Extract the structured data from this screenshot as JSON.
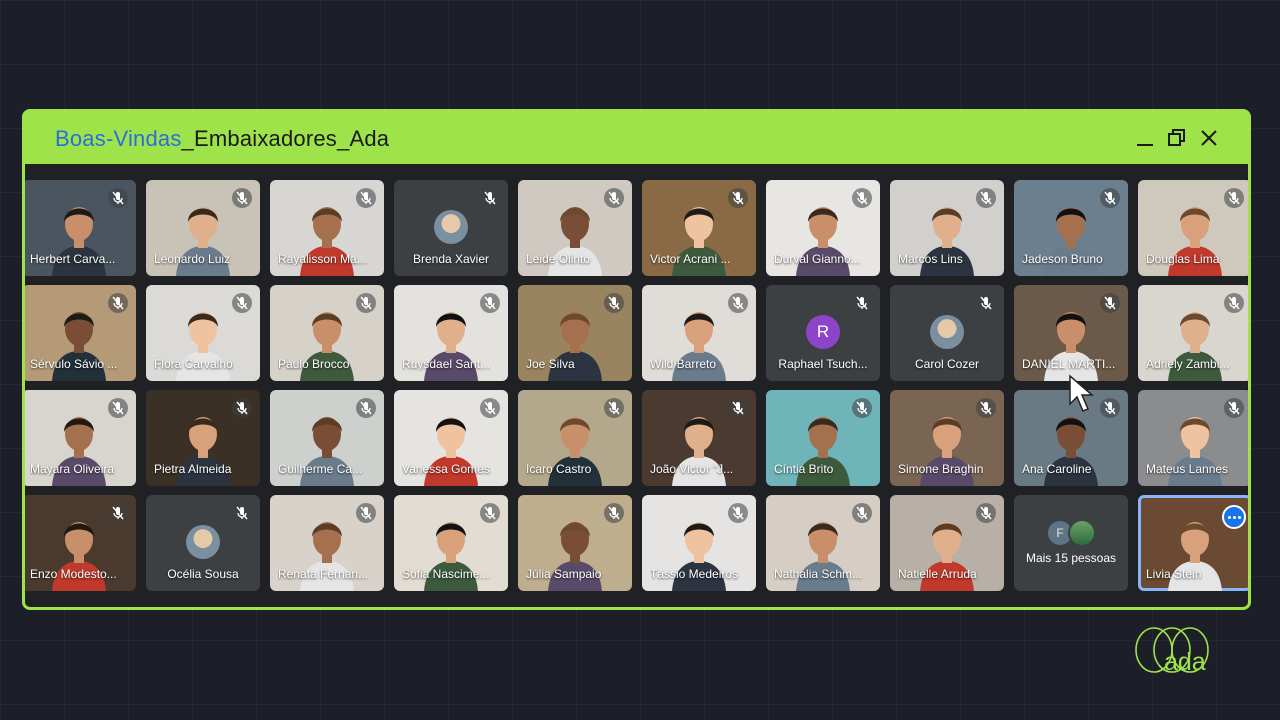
{
  "window": {
    "title_accent": "Boas-Vindas",
    "title_rest": "_Embaixadores_Ada",
    "controls": [
      "minimize-icon",
      "restore-icon",
      "close-icon"
    ]
  },
  "participants": [
    {
      "name": "Herbert Carva...",
      "type": "video",
      "muted": true,
      "bg": "#4a5560"
    },
    {
      "name": "Leonardo Luiz",
      "type": "video",
      "muted": true,
      "bg": "#c9c2b6"
    },
    {
      "name": "Rayalisson Ma...",
      "type": "video",
      "muted": true,
      "bg": "#d8d6d2"
    },
    {
      "name": "Brenda Xavier",
      "type": "avatar",
      "muted": true,
      "bg": "#3c4043"
    },
    {
      "name": "Leide Olinto",
      "type": "video",
      "muted": true,
      "bg": "#cfc9c1"
    },
    {
      "name": "Victor Acrani ...",
      "type": "video",
      "muted": true,
      "bg": "#8a6a44"
    },
    {
      "name": "Durval Gianno...",
      "type": "video",
      "muted": true,
      "bg": "#e8e6e2"
    },
    {
      "name": "Marcos Lins",
      "type": "video",
      "muted": true,
      "bg": "#d2d0cc"
    },
    {
      "name": "Jadeson Bruno",
      "type": "video",
      "muted": true,
      "bg": "#6c7f8f"
    },
    {
      "name": "Douglas Lima",
      "type": "video",
      "muted": true,
      "bg": "#cfc8bc"
    },
    {
      "name": "Sérvulo Sávio ...",
      "type": "video",
      "muted": true,
      "bg": "#b49a76"
    },
    {
      "name": "Flora Carvalho",
      "type": "video",
      "muted": true,
      "bg": "#dcdad6"
    },
    {
      "name": "Paulo Brocco",
      "type": "video",
      "muted": true,
      "bg": "#d6d1c9"
    },
    {
      "name": "Ruysdael Sant...",
      "type": "video",
      "muted": true,
      "bg": "#e4e2de"
    },
    {
      "name": "Joe Silva",
      "type": "video",
      "muted": true,
      "bg": "#9a8460"
    },
    {
      "name": "Wild Barreto",
      "type": "video",
      "muted": true,
      "bg": "#e0ddd8"
    },
    {
      "name": "Raphael Tsuch...",
      "type": "initial",
      "initial": "R",
      "muted": true,
      "bg": "#3c4043"
    },
    {
      "name": "Carol Cozer",
      "type": "avatar",
      "muted": true,
      "bg": "#3c4043"
    },
    {
      "name": "DANIEL MARTI...",
      "type": "video",
      "muted": true,
      "bg": "#6b5a4a"
    },
    {
      "name": "Adriely Zambi...",
      "type": "video",
      "muted": true,
      "bg": "#d9d5cf"
    },
    {
      "name": "Mayara Oliveira",
      "type": "video",
      "muted": true,
      "bg": "#d8d4ce"
    },
    {
      "name": "Pietra Almeida",
      "type": "video",
      "muted": true,
      "bg": "#3a3026"
    },
    {
      "name": "Guilherme Ca...",
      "type": "video",
      "muted": true,
      "bg": "#cdd0cd"
    },
    {
      "name": "Vanessa Gomes",
      "type": "video",
      "muted": true,
      "bg": "#e6e4e0"
    },
    {
      "name": "Icaro Castro",
      "type": "video",
      "muted": true,
      "bg": "#b4a88c"
    },
    {
      "name": "João Victor “J...",
      "type": "video",
      "muted": true,
      "bg": "#4a3a30"
    },
    {
      "name": "Cíntia Brito",
      "type": "video",
      "muted": true,
      "bg": "#6fb4b8"
    },
    {
      "name": "Simone Braghin",
      "type": "video",
      "muted": true,
      "bg": "#7a6552"
    },
    {
      "name": "Ana Caroline",
      "type": "video",
      "muted": true,
      "bg": "#6a7a84"
    },
    {
      "name": "Mateus Lannes",
      "type": "video",
      "muted": true,
      "bg": "#8a8c8e"
    },
    {
      "name": "Enzo Modesto...",
      "type": "video",
      "muted": true,
      "bg": "#4a3a2e"
    },
    {
      "name": "Océlia Sousa",
      "type": "avatar",
      "muted": true,
      "bg": "#3c4043"
    },
    {
      "name": "Renata Fernan...",
      "type": "video",
      "muted": true,
      "bg": "#d8d2ca"
    },
    {
      "name": "Sofia Nascime...",
      "type": "video",
      "muted": true,
      "bg": "#e2dcd2"
    },
    {
      "name": "Júlia Sampaio",
      "type": "video",
      "muted": true,
      "bg": "#bfae8e"
    },
    {
      "name": "Tássio Medeiros",
      "type": "video",
      "muted": true,
      "bg": "#e6e4e2"
    },
    {
      "name": "Nathalia Schm...",
      "type": "video",
      "muted": true,
      "bg": "#d6cec4"
    },
    {
      "name": "Natielle Arruda",
      "type": "video",
      "muted": true,
      "bg": "#b8b0a6"
    },
    {
      "name": "Mais 15 pessoas",
      "type": "more",
      "initial": "F",
      "muted": false,
      "bg": "#3c4043"
    },
    {
      "name": "Livia Stein",
      "type": "video",
      "muted": false,
      "active": true,
      "bg": "#6a4a32"
    }
  ],
  "brand": {
    "logo_text": "ada",
    "accent": "#9fe34a"
  }
}
